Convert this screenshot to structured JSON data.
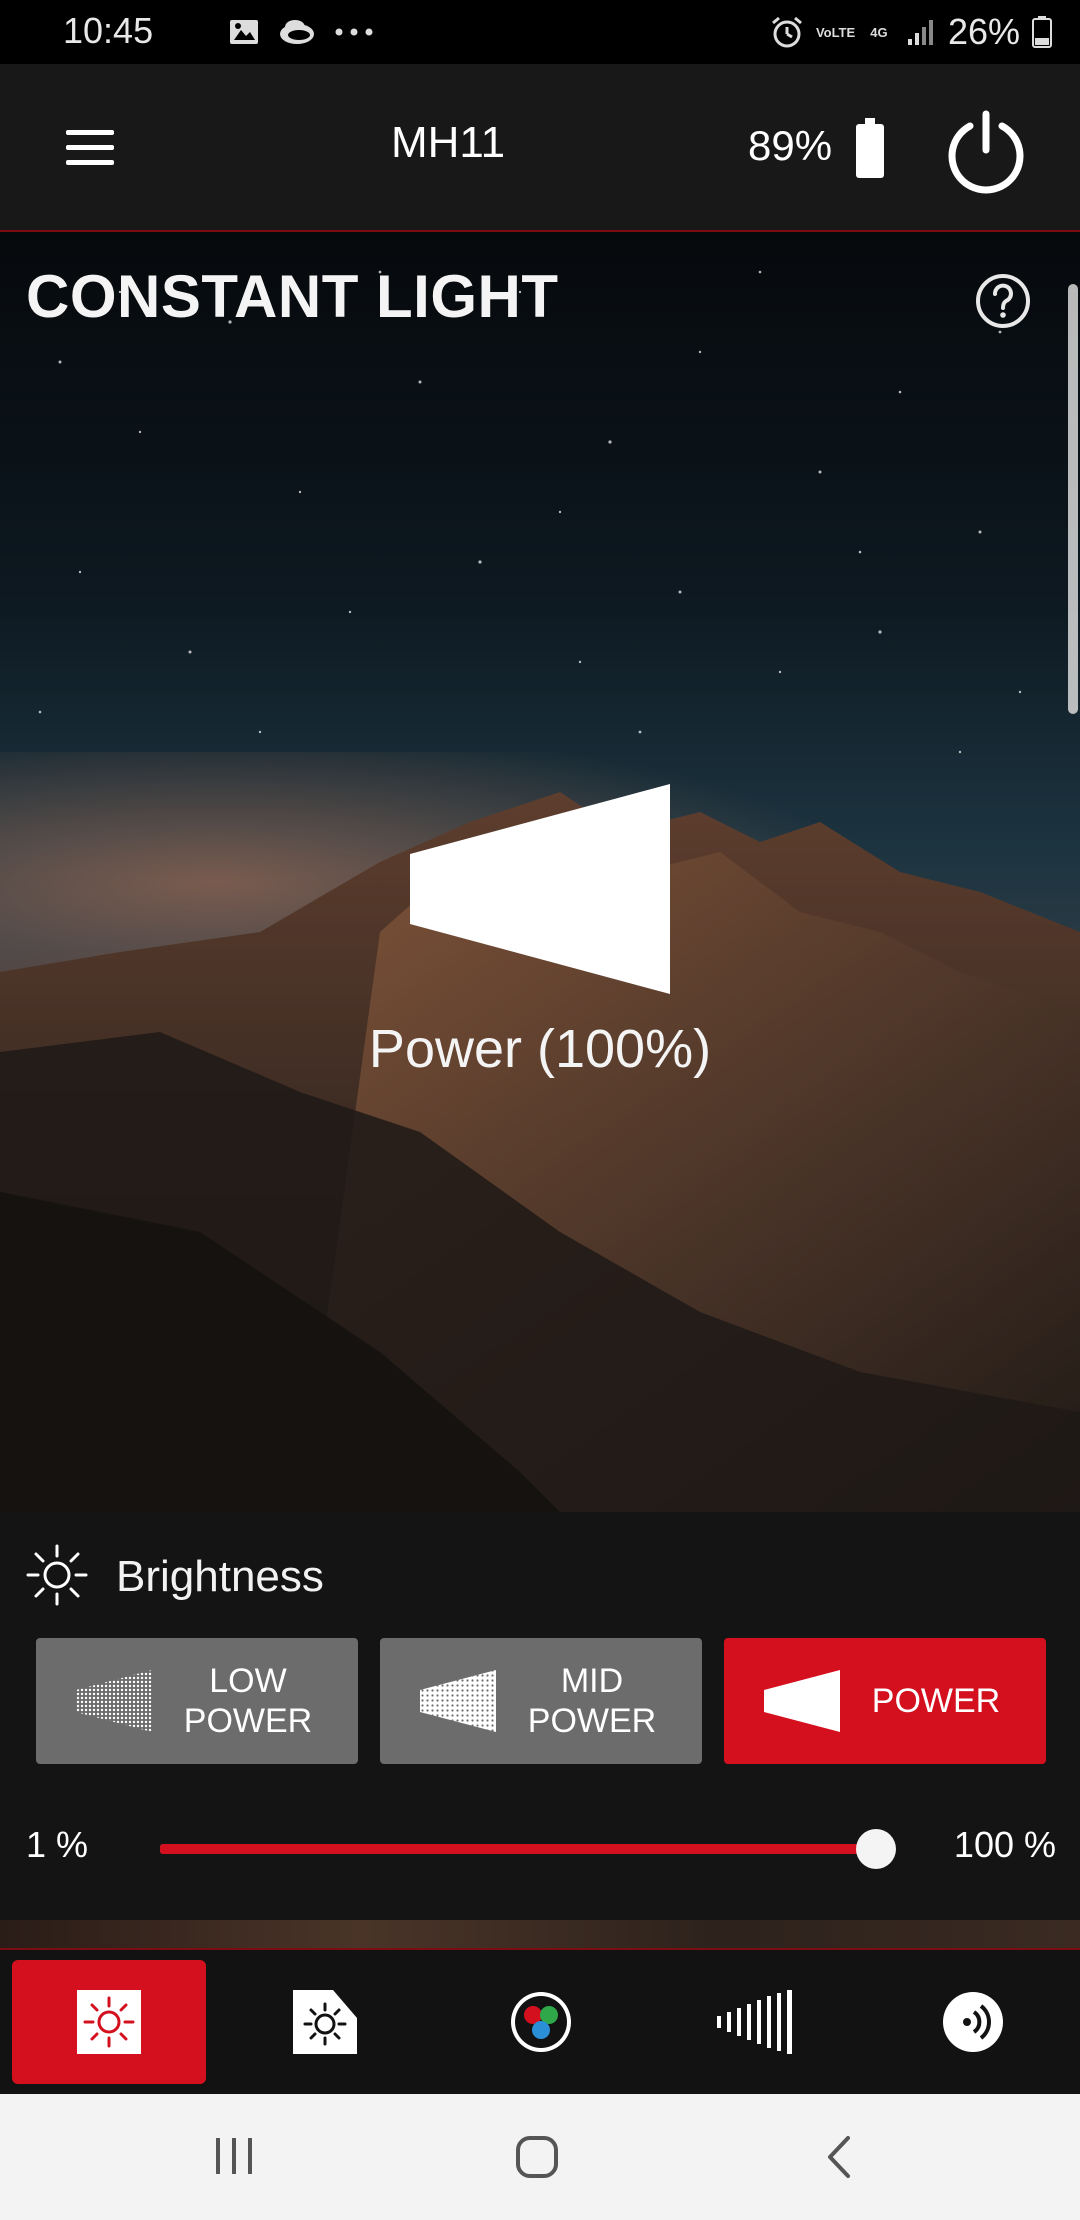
{
  "status_bar": {
    "time": "10:45",
    "left_icons": [
      "image-icon",
      "cloud-icon",
      "more-dots-icon"
    ],
    "right_icons": [
      "alarm-icon",
      "volte-icon",
      "4g-icon",
      "signal-icon"
    ],
    "volte_badge": "VoLTE",
    "network_badge": "4G",
    "battery_percent": "26%"
  },
  "app_bar": {
    "device_name": "MH11",
    "device_battery": "89%"
  },
  "hero": {
    "mode_title": "CONSTANT LIGHT",
    "power_status": "Power  (100%)"
  },
  "brightness": {
    "label": "Brightness",
    "modes": [
      {
        "label": "LOW\nPOWER",
        "active": false
      },
      {
        "label": "MID\nPOWER",
        "active": false
      },
      {
        "label": "POWER",
        "active": true
      }
    ],
    "slider": {
      "min_label": "1 %",
      "max_label": "100 %",
      "value_percent": 100
    }
  },
  "tabs": [
    {
      "name": "constant-light-tab",
      "icon": "sun-icon",
      "active": true
    },
    {
      "name": "flash-tab",
      "icon": "sun-flash-icon",
      "active": false
    },
    {
      "name": "rgb-tab",
      "icon": "rgb-icon",
      "active": false
    },
    {
      "name": "effects-tab",
      "icon": "fade-bars-icon",
      "active": false
    },
    {
      "name": "sound-tab",
      "icon": "sound-wave-icon",
      "active": false
    }
  ],
  "colors": {
    "accent": "#d4101f",
    "inactive_button": "#6c6c6c",
    "panel_bg": "#141414",
    "app_bar_bg": "#181818"
  }
}
